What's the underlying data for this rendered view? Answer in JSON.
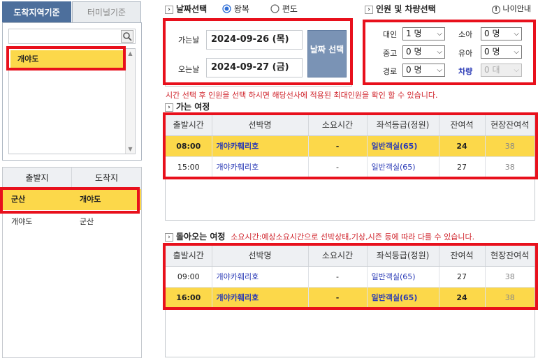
{
  "left": {
    "tabs": [
      "도착지역기준",
      "터미널기준"
    ],
    "region_list": [
      "개야도"
    ],
    "route_headers": [
      "출발지",
      "도착지"
    ],
    "routes": [
      {
        "from": "군산",
        "to": "개야도"
      },
      {
        "from": "개야도",
        "to": "군산"
      }
    ]
  },
  "date": {
    "title": "날짜선택",
    "trip_options": [
      "왕복",
      "편도"
    ],
    "depart_label": "가는날",
    "depart_value": "2024-09-26 (목)",
    "return_label": "오는날",
    "return_value": "2024-09-27 (금)",
    "select_button": "날짜 선택"
  },
  "people": {
    "title": "인원 및 차량선택",
    "age_guide": "나이안내",
    "adult_label": "대인",
    "adult_value": "1 명",
    "child_label": "소아",
    "child_value": "0 명",
    "middle_label": "중고",
    "middle_value": "0 명",
    "infant_label": "유아",
    "infant_value": "0 명",
    "senior_label": "경로",
    "senior_value": "0 명",
    "vehicle_label": "차량",
    "vehicle_value": "0 대"
  },
  "notice": "시간 선택 후 인원을 선택 하시면 해당선사에 적용된 최대인원을 확인 할 수 있습니다.",
  "outbound": {
    "title": "가는 여정",
    "headers": [
      "출발시간",
      "선박명",
      "소요시간",
      "좌석등급(정원)",
      "잔여석",
      "현장잔여석"
    ],
    "rows": [
      {
        "time": "08:00",
        "ship": "개야카훼리호",
        "duration": "-",
        "seat": "일반객실(65)",
        "remain": "24",
        "onsite": "38"
      },
      {
        "time": "15:00",
        "ship": "개야카훼리호",
        "duration": "-",
        "seat": "일반객실(65)",
        "remain": "27",
        "onsite": "38"
      }
    ]
  },
  "return": {
    "title": "돌아오는 여정",
    "note": "소요시간:예상소요시간으로 선박상태,기상,시즌 등에 따라 다를 수 있습니다.",
    "headers": [
      "출발시간",
      "선박명",
      "소요시간",
      "좌석등급(정원)",
      "잔여석",
      "현장잔여석"
    ],
    "rows": [
      {
        "time": "09:00",
        "ship": "개야카훼리호",
        "duration": "-",
        "seat": "일반객실(65)",
        "remain": "27",
        "onsite": "38"
      },
      {
        "time": "16:00",
        "ship": "개야카훼리호",
        "duration": "-",
        "seat": "일반객실(65)",
        "remain": "24",
        "onsite": "38"
      }
    ]
  },
  "colors": {
    "highlight": "#fcd84a",
    "annotation": "#e8101c",
    "tab_active": "#4d6f9c",
    "link": "#2a3ab6"
  }
}
